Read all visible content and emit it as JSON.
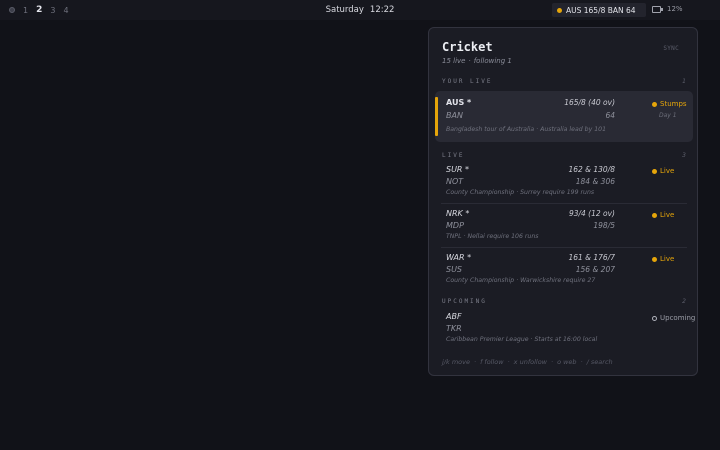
{
  "topbar": {
    "workspaces": [
      "1",
      "2",
      "3",
      "4"
    ],
    "active_workspace": "2",
    "day": "Saturday",
    "time": "12:22",
    "score_chip": "AUS 165/8  BAN 64",
    "battery": "12%"
  },
  "panel": {
    "title": "Cricket",
    "sync": "SYNC",
    "live_count": "15 live",
    "following": "following 1",
    "sections": {
      "your_live": {
        "label": "YOUR LIVE",
        "count": "1"
      },
      "live": {
        "label": "LIVE",
        "count": "3"
      },
      "upcoming": {
        "label": "UPCOMING",
        "count": "2"
      }
    },
    "featured": {
      "team1": "AUS *",
      "score1": "165/8 (40 ov)",
      "team2": "BAN",
      "score2": "64",
      "status": "Stumps",
      "status_sub": "Day 1",
      "series": "Bangladesh tour of Australia",
      "note": "Australia lead by 101"
    },
    "live_matches": [
      {
        "team1": "SUR *",
        "score1": "162 & 130/8",
        "team2": "NOT",
        "score2": "184 & 306",
        "status": "Live",
        "series": "County Championship",
        "note": "Surrey require 199 runs"
      },
      {
        "team1": "NRK *",
        "score1": "93/4 (12 ov)",
        "team2": "MDP",
        "score2": "198/5",
        "status": "Live",
        "series": "TNPL",
        "note": "Nellai require 106 runs"
      },
      {
        "team1": "WAR *",
        "score1": "161 & 176/7",
        "team2": "SUS",
        "score2": "156 & 207",
        "status": "Live",
        "series": "County Championship",
        "note": "Warwickshire require 27"
      }
    ],
    "upcoming_matches": [
      {
        "team1": "ABF",
        "team2": "TKR",
        "status": "Upcoming",
        "series": "Caribbean Premier League",
        "note": "Starts at 16:00 local"
      }
    ],
    "footer": [
      "j/k move",
      "f follow",
      "x unfollow",
      "o web",
      "/ search"
    ],
    "sep": "·"
  },
  "colors": {
    "accent": "#e5a50a",
    "background": "#111218",
    "panel": "#1b1c24"
  }
}
